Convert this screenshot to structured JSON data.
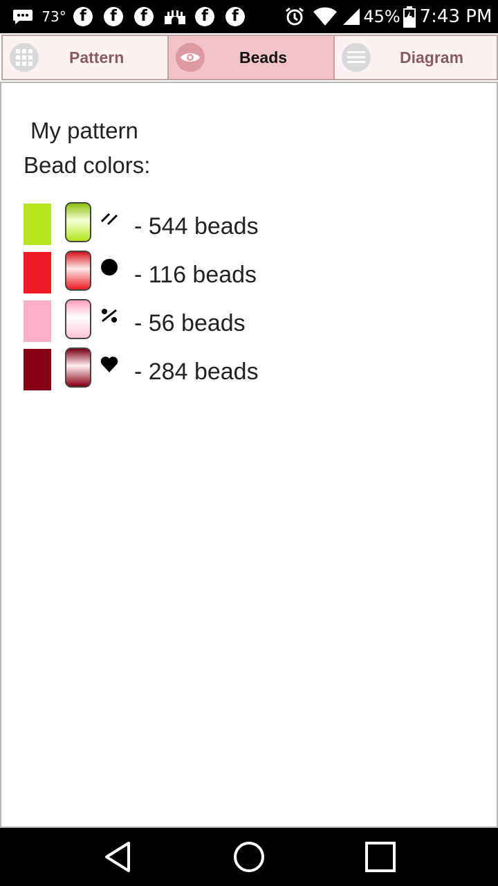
{
  "status_bar": {
    "temperature": "73°",
    "battery": "45%",
    "time": "7:43 PM",
    "icons": [
      "chat-icon",
      "facebook-icon",
      "facebook-icon",
      "facebook-icon",
      "castle-icon",
      "facebook-icon",
      "facebook-icon",
      "alarm-icon",
      "wifi-icon",
      "signal-icon",
      "battery-icon"
    ]
  },
  "tabs": [
    {
      "label": "Pattern",
      "icon": "grid-icon",
      "active": false
    },
    {
      "label": "Beads",
      "icon": "eye-icon",
      "active": true
    },
    {
      "label": "Diagram",
      "icon": "menu-icon",
      "active": false
    }
  ],
  "content": {
    "title": "My pattern",
    "subtitle": "Bead colors:",
    "beads": [
      {
        "color": "#b5e61d",
        "symbol": "⁄⁄",
        "symbol_name": "double-slash-icon",
        "count_text": "- 544 beads"
      },
      {
        "color": "#ed1c24",
        "symbol": "●",
        "symbol_name": "dot-icon",
        "count_text": "- 116 beads"
      },
      {
        "color": "#ffaec9",
        "symbol": "%",
        "symbol_name": "percent-icon",
        "count_text": "- 56 beads"
      },
      {
        "color": "#880015",
        "symbol": "♥",
        "symbol_name": "heart-icon",
        "count_text": "- 284 beads"
      }
    ]
  },
  "nav": {
    "buttons": [
      "back-button",
      "home-button",
      "recents-button"
    ]
  }
}
